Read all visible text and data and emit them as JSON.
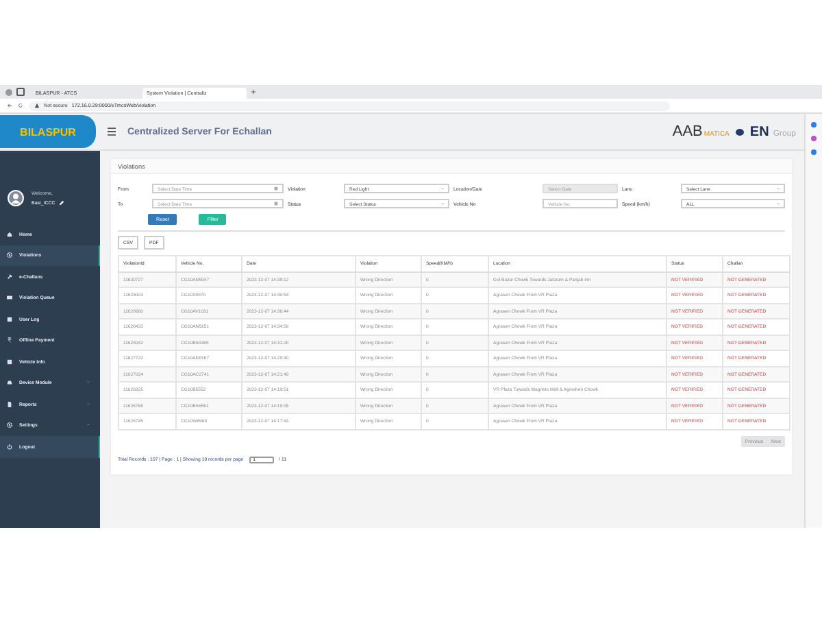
{
  "browser": {
    "tabs": [
      {
        "label": "BILASPUR - ATCS",
        "selected": false
      },
      {
        "label": "System Violation | Centraliz",
        "selected": true
      }
    ],
    "address": {
      "security": "Not secure",
      "url": "172.16.0.29:0000/eTmcsWeb/violation"
    }
  },
  "header": {
    "logo": "BILASPUR",
    "title": "Centralized Server For Echallan",
    "partner_logo": [
      "AAB",
      "MATICA",
      "EN",
      "Group"
    ]
  },
  "sidebar": {
    "welcome": "Welcome,",
    "user": "Basi_ICCC",
    "items": [
      {
        "label": "Home",
        "selected": false,
        "expandable": false
      },
      {
        "label": "Violations",
        "selected": true,
        "expandable": false
      },
      {
        "label": "e-Challans",
        "selected": false,
        "expandable": false
      },
      {
        "label": "Violation Queue",
        "selected": false,
        "expandable": false
      },
      {
        "label": "User Log",
        "selected": false,
        "expandable": false
      },
      {
        "label": "Offline Payment",
        "selected": false,
        "expandable": false
      },
      {
        "label": "Vehicle Info",
        "selected": false,
        "expandable": false
      },
      {
        "label": "Device Module",
        "selected": false,
        "expandable": true
      },
      {
        "label": "Reports",
        "selected": false,
        "expandable": true
      },
      {
        "label": "Settings",
        "selected": false,
        "expandable": true
      },
      {
        "label": "Logout",
        "selected": true,
        "expandable": false
      }
    ]
  },
  "page": {
    "title": "Violations",
    "filters": [
      {
        "label": "From",
        "kind": "date",
        "placeholder": "Select Date Time"
      },
      {
        "label": "Violation",
        "kind": "select",
        "value": "Red Light"
      },
      {
        "label": "Location/Gate",
        "kind": "disabled",
        "placeholder": "Select Gate"
      },
      {
        "label": "Lane",
        "kind": "select",
        "value": "Select Lane"
      },
      {
        "label": "To",
        "kind": "date",
        "placeholder": "Select Date Time"
      },
      {
        "label": "Status",
        "kind": "select",
        "value": "Select Status"
      },
      {
        "label": "Vehicle No",
        "kind": "text",
        "placeholder": "Vehicle No."
      },
      {
        "label": "Speed (km/h)",
        "kind": "select",
        "value": "ALL"
      }
    ],
    "buttons": [
      "Reset",
      "Filter"
    ],
    "exports": [
      "CSV",
      "PDF"
    ],
    "table": {
      "columns": [
        "ViolationId",
        "Vehicle No.",
        "Date",
        "Violation",
        "Speed(KM/h)",
        "Location",
        "Status",
        "Challan"
      ],
      "rows": [
        [
          "11630727",
          "CG10AN5947",
          "2023-12-07 14:39:12",
          "Wrong Direction",
          "0",
          "Gol Bazar Chowk Towards Jalaram & Panjab Inn",
          "NOT VERIFIED",
          "NOT GENERATED"
        ],
        [
          "11629003",
          "CG10X8870",
          "2023-12-07 14:40:54",
          "Wrong Direction",
          "0",
          "Agrasen Chowk From VR Plaza",
          "NOT VERIFIED",
          "NOT GENERATED"
        ],
        [
          "11628660",
          "CG10AV1031",
          "2023-12-07 14:36:44",
          "Wrong Direction",
          "0",
          "Agrasen Chowk From VR Plaza",
          "NOT VERIFIED",
          "NOT GENERATED"
        ],
        [
          "11628433",
          "CG10AN5151",
          "2023-12-07 14:34:56",
          "Wrong Direction",
          "0",
          "Agrasen Chowk From VR Plaza",
          "NOT VERIFIED",
          "NOT GENERATED"
        ],
        [
          "11628042",
          "CG10BS8365",
          "2023-12-07 14:31:28",
          "Wrong Direction",
          "0",
          "Agrasen Chowk From VR Plaza",
          "NOT VERIFIED",
          "NOT GENERATED"
        ],
        [
          "11627722",
          "CG10AD8167",
          "2023-12-07 14:29:30",
          "Wrong Direction",
          "0",
          "Agrasen Chowk From VR Plaza",
          "NOT VERIFIED",
          "NOT GENERATED"
        ],
        [
          "11627024",
          "CG10AC2741",
          "2023-12-07 14:21:49",
          "Wrong Direction",
          "0",
          "Agrasen Chowk From VR Plaza",
          "NOT VERIFIED",
          "NOT GENERATED"
        ],
        [
          "11626825",
          "CG10B5552",
          "2023-12-07 14:19:51",
          "Wrong Direction",
          "0",
          "VR Plaza Towards Magneto Mall & Agreshen Chowk",
          "NOT VERIFIED",
          "NOT GENERATED"
        ],
        [
          "11626765",
          "CG10BS6561",
          "2023-12-07 14:19:05",
          "Wrong Direction",
          "0",
          "Agrasen Chowk From VR Plaza",
          "NOT VERIFIED",
          "NOT GENERATED"
        ],
        [
          "11626745",
          "CG10W6968",
          "2023-12-07 14:17:43",
          "Wrong Direction",
          "0",
          "Agrasen Chowk From VR Plaza",
          "NOT VERIFIED",
          "NOT GENERATED"
        ]
      ]
    },
    "pager": {
      "buttons": [
        "Previous",
        "Next"
      ],
      "summary": "Total Records : 107 | Page : 1 | Showing 10 records per page",
      "page": "1",
      "of": "/ 11"
    }
  }
}
